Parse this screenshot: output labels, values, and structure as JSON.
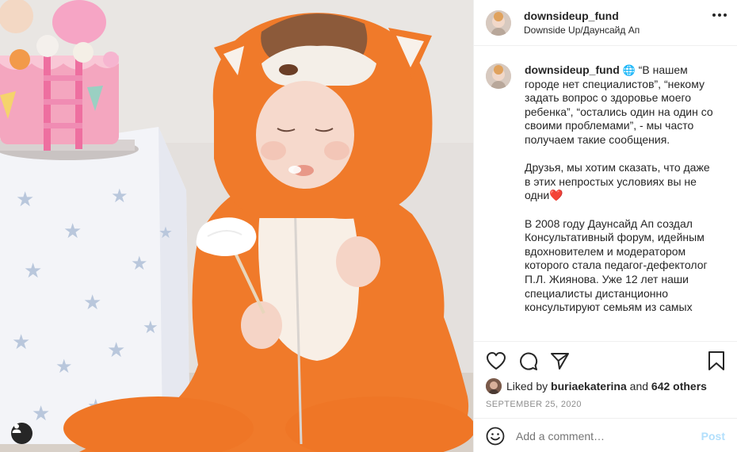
{
  "header": {
    "username": "downsideup_fund",
    "subtitle": "Downside Up/Даунсайд Ап"
  },
  "caption": {
    "username": "downsideup_fund",
    "paragraphs": [
      "“В нашем городе нет специалистов”, “некому задать вопрос о здоровье моего ребенка”, “остались один на один со своими проблемами”, - мы часто получаем такие сообщения.",
      "Друзья, мы хотим сказать, что даже в этих непростых условиях вы не одни",
      "В 2008 году Даунсайд Ап создал Консультативный форум, идейным вдохновителем и модератором которого стала педагог-дефектолог П.Л. Жиянова. Уже 12 лет наши специалисты дистанционно консультируют семьям из самых"
    ],
    "heart_emoji": "❤️"
  },
  "likes": {
    "prefix": "Liked by",
    "user": "buriaekaterina",
    "joiner": "and",
    "count_text": "642 others"
  },
  "date": "SEPTEMBER 25, 2020",
  "comment": {
    "placeholder": "Add a comment…",
    "post_label": "Post"
  },
  "icons": {
    "like": "heart-outline-icon",
    "comment": "speech-bubble-icon",
    "share": "paper-plane-icon",
    "save": "bookmark-icon",
    "emoji": "smiley-icon",
    "more": "three-dots-icon",
    "user_tag": "person-icon"
  },
  "colors": {
    "text": "#262626",
    "muted": "#8e8e8e",
    "post_disabled": "#b2dffc",
    "costume_orange": "#f07a2a"
  }
}
